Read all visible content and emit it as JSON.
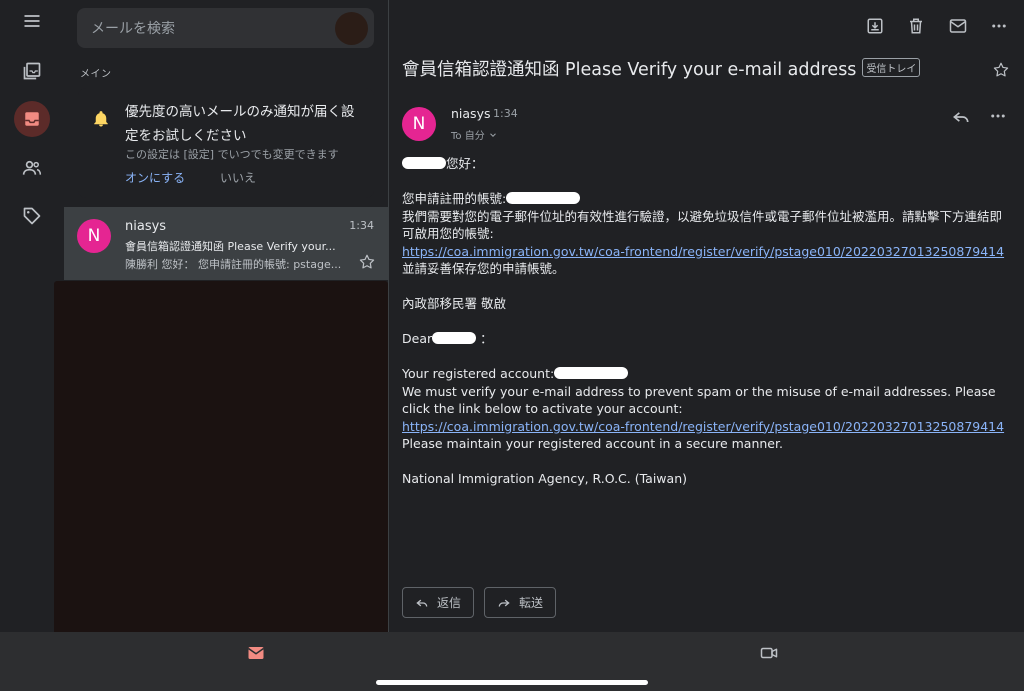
{
  "search": {
    "placeholder": "メールを検索"
  },
  "list": {
    "section_label": "メイン",
    "promo": {
      "title": "優先度の高いメールのみ通知が届く設定をお試しください",
      "subtitle": "この設定は [設定] でいつでも変更できます",
      "on_label": "オンにする",
      "no_label": "いいえ"
    },
    "mail": {
      "avatar_letter": "N",
      "from": "niasys",
      "time": "1:34",
      "subject": "會員信箱認證通知函 Please Verify your...",
      "snippet": "陳勝利 您好： 您申請註冊的帳號: pstage..."
    }
  },
  "message": {
    "subject": "會員信箱認證通知函 Please Verify your e-mail address",
    "label": "受信トレイ",
    "sender_letter": "N",
    "sender": "niasys",
    "time": "1:34",
    "to": "To 自分",
    "greeting_zh": "您好：",
    "account_zh": "您申請註冊的帳號:",
    "verify_zh": "我們需要對您的電子郵件位址的有效性進行驗證，以避免垃圾信件或電子郵件位址被濫用。請點擊下方連結即可啟用您的帳號:",
    "link": "https://coa.immigration.gov.tw/coa-frontend/register/verify/pstage010/20220327013250879414",
    "keep_zh": "並請妥善保存您的申請帳號。",
    "sign_zh": "內政部移民署 敬啟",
    "dear": "Dear",
    "dear_colon": "：",
    "account_en": "Your registered account:",
    "verify_en": "We must verify your e-mail address to prevent spam or the misuse of e-mail addresses. Please click the link below to activate your account:",
    "keep_en": "Please maintain your registered account in a secure manner.",
    "sign_en": "National Immigration Agency, R.O.C. (Taiwan)",
    "reply_label": "返信",
    "forward_label": "転送"
  },
  "icons": {
    "menu": "menu-icon",
    "all_inboxes": "all-inboxes-icon",
    "inbox": "inbox-icon",
    "contacts": "contacts-icon",
    "labels": "label-icon",
    "archive": "archive-icon",
    "delete": "trash-icon",
    "unread": "mail-icon",
    "more": "more-icon",
    "bell": "bell-icon",
    "star": "star-icon",
    "reply": "reply-icon",
    "forward": "forward-icon",
    "mail_tab": "mail-icon",
    "meet_tab": "video-icon"
  },
  "colors": {
    "accent_pink": "#e52592",
    "link": "#8ab4f8",
    "active_rail": "#5c2b29",
    "mail_tab": "#f28b82"
  }
}
